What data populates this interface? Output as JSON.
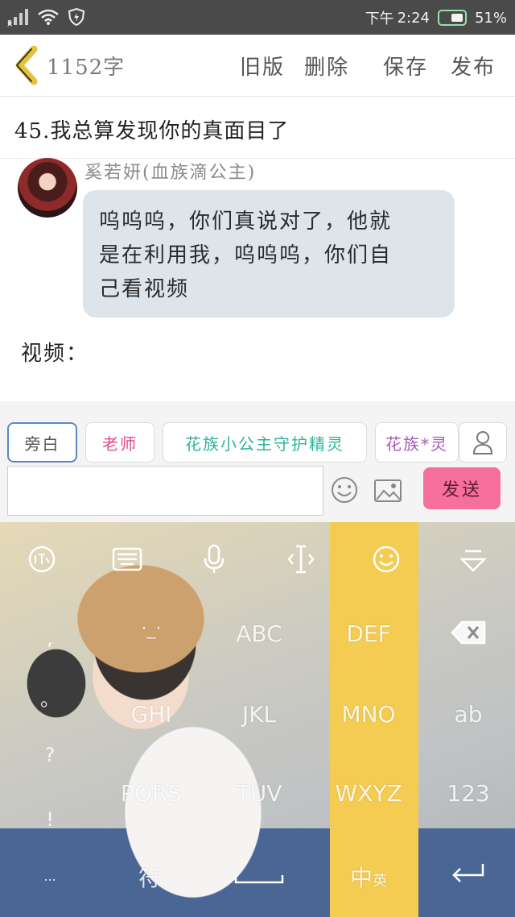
{
  "status": {
    "signal": "×",
    "time_prefix": "下午",
    "time": "2:24",
    "battery": "51%"
  },
  "header": {
    "word_count": "1152字",
    "old_version": "旧版",
    "delete": "删除",
    "save": "保存",
    "publish": "发布"
  },
  "chapter_title": "45.我总算发现你的真面目了",
  "message": {
    "speaker": "奚若妍(血族滴公主)",
    "lines": [
      "呜呜呜，你们真说对了，他就",
      "是在利用我，呜呜呜，你们自",
      "己看视频"
    ]
  },
  "body_text": "视频：",
  "roles": [
    "旁白",
    "老师",
    "花族小公主守护精灵",
    "花族*灵"
  ],
  "composer": {
    "input_value": "",
    "send": "发送"
  },
  "keyboard": {
    "punctuation": [
      ",",
      "。",
      "?",
      "!",
      "..."
    ],
    "keys": {
      "abc": "ABC",
      "def": "DEF",
      "ghi": "GHI",
      "jkl": "JKL",
      "mno": "MNO",
      "pqrs": "PQRS",
      "tuv": "TUV",
      "wxyz": "WXYZ",
      "ab": "ab",
      "num": "123",
      "symbol": "符",
      "lang_main": "中",
      "lang_sub": "英"
    }
  },
  "colors": {
    "send": "#f76f9c",
    "bubble": "#dde4ea",
    "active_role_border": "#5c87c7"
  }
}
